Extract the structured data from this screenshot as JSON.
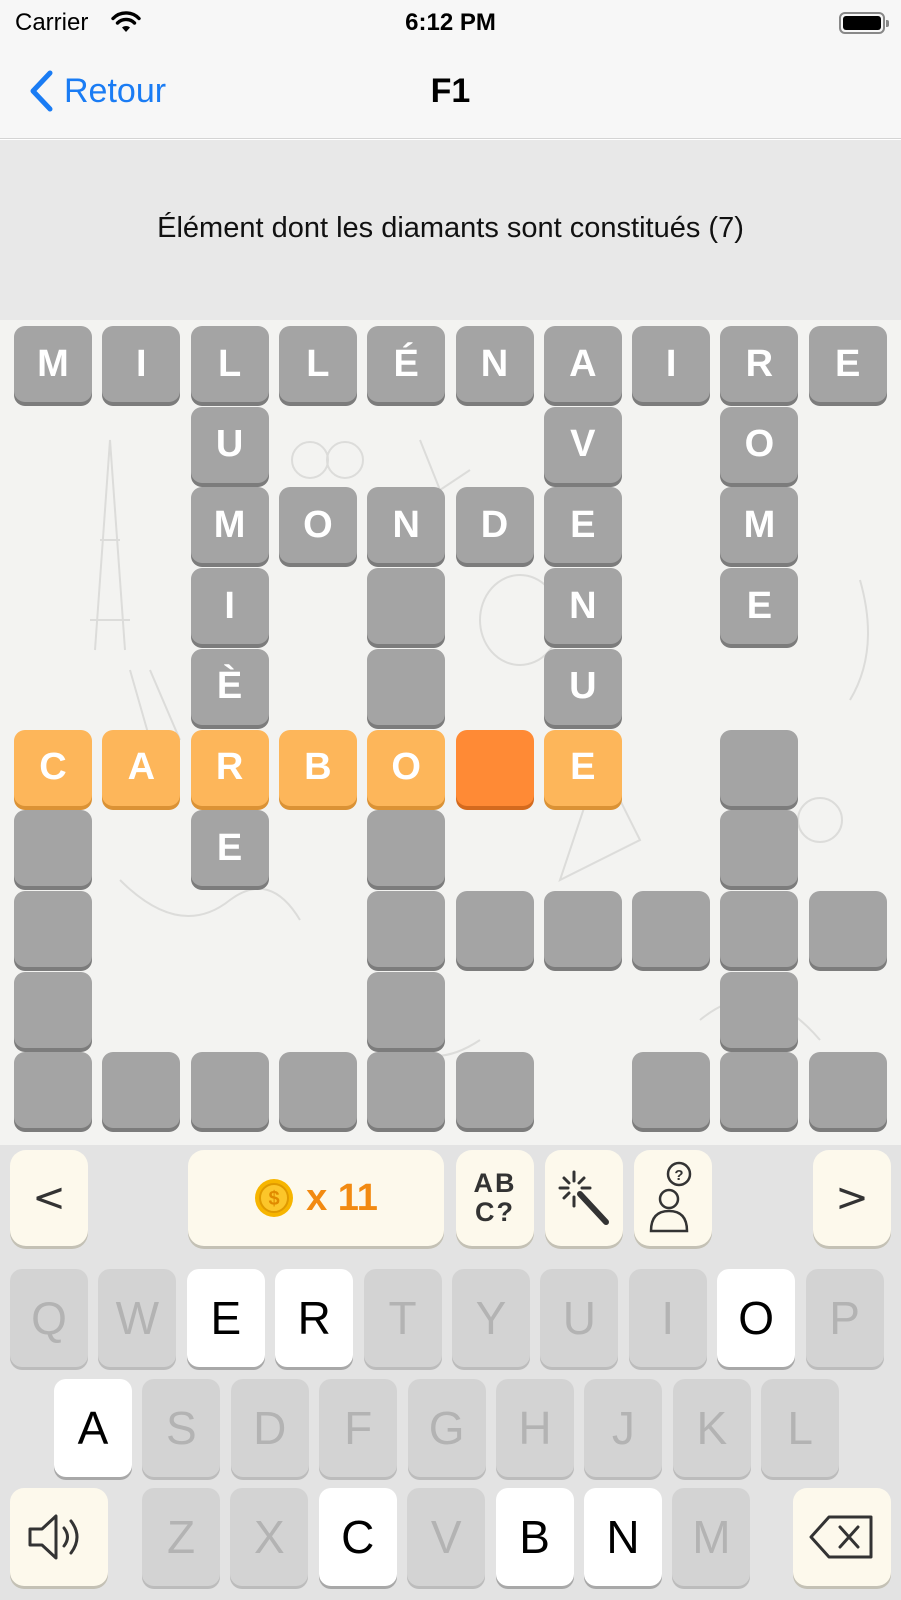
{
  "status_bar": {
    "carrier": "Carrier",
    "time": "6:12 PM"
  },
  "nav": {
    "back_label": "Retour",
    "title": "F1"
  },
  "clue": {
    "text": "Élément dont les diamants sont constitués (7)"
  },
  "colors": {
    "accent": "#1a7cf4",
    "cell_filled": "#a4a4a4",
    "cell_active": "#fdb65a",
    "cell_current": "#ff8a35",
    "coin": "#f7b500",
    "coin_text": "#f28a12"
  },
  "grid": {
    "columns": 10,
    "rows": 10,
    "cells": [
      {
        "row": 0,
        "col": 0,
        "letter": "M",
        "state": "filled"
      },
      {
        "row": 0,
        "col": 1,
        "letter": "I",
        "state": "filled"
      },
      {
        "row": 0,
        "col": 2,
        "letter": "L",
        "state": "filled"
      },
      {
        "row": 0,
        "col": 3,
        "letter": "L",
        "state": "filled"
      },
      {
        "row": 0,
        "col": 4,
        "letter": "É",
        "state": "filled"
      },
      {
        "row": 0,
        "col": 5,
        "letter": "N",
        "state": "filled"
      },
      {
        "row": 0,
        "col": 6,
        "letter": "A",
        "state": "filled"
      },
      {
        "row": 0,
        "col": 7,
        "letter": "I",
        "state": "filled"
      },
      {
        "row": 0,
        "col": 8,
        "letter": "R",
        "state": "filled"
      },
      {
        "row": 0,
        "col": 9,
        "letter": "E",
        "state": "filled"
      },
      {
        "row": 1,
        "col": 2,
        "letter": "U",
        "state": "filled"
      },
      {
        "row": 1,
        "col": 6,
        "letter": "V",
        "state": "filled"
      },
      {
        "row": 1,
        "col": 8,
        "letter": "O",
        "state": "filled"
      },
      {
        "row": 2,
        "col": 2,
        "letter": "M",
        "state": "filled"
      },
      {
        "row": 2,
        "col": 3,
        "letter": "O",
        "state": "filled"
      },
      {
        "row": 2,
        "col": 4,
        "letter": "N",
        "state": "filled"
      },
      {
        "row": 2,
        "col": 5,
        "letter": "D",
        "state": "filled"
      },
      {
        "row": 2,
        "col": 6,
        "letter": "E",
        "state": "filled"
      },
      {
        "row": 2,
        "col": 8,
        "letter": "M",
        "state": "filled"
      },
      {
        "row": 3,
        "col": 2,
        "letter": "I",
        "state": "filled"
      },
      {
        "row": 3,
        "col": 4,
        "letter": "",
        "state": "filled"
      },
      {
        "row": 3,
        "col": 6,
        "letter": "N",
        "state": "filled"
      },
      {
        "row": 3,
        "col": 8,
        "letter": "E",
        "state": "filled"
      },
      {
        "row": 4,
        "col": 2,
        "letter": "È",
        "state": "filled"
      },
      {
        "row": 4,
        "col": 4,
        "letter": "",
        "state": "filled"
      },
      {
        "row": 4,
        "col": 6,
        "letter": "U",
        "state": "filled"
      },
      {
        "row": 5,
        "col": 0,
        "letter": "C",
        "state": "active"
      },
      {
        "row": 5,
        "col": 1,
        "letter": "A",
        "state": "active"
      },
      {
        "row": 5,
        "col": 2,
        "letter": "R",
        "state": "active"
      },
      {
        "row": 5,
        "col": 3,
        "letter": "B",
        "state": "active"
      },
      {
        "row": 5,
        "col": 4,
        "letter": "O",
        "state": "active"
      },
      {
        "row": 5,
        "col": 5,
        "letter": "",
        "state": "current"
      },
      {
        "row": 5,
        "col": 6,
        "letter": "E",
        "state": "active"
      },
      {
        "row": 5,
        "col": 8,
        "letter": "",
        "state": "filled"
      },
      {
        "row": 6,
        "col": 0,
        "letter": "",
        "state": "filled"
      },
      {
        "row": 6,
        "col": 2,
        "letter": "E",
        "state": "filled"
      },
      {
        "row": 6,
        "col": 4,
        "letter": "",
        "state": "filled"
      },
      {
        "row": 6,
        "col": 8,
        "letter": "",
        "state": "filled"
      },
      {
        "row": 7,
        "col": 0,
        "letter": "",
        "state": "filled"
      },
      {
        "row": 7,
        "col": 4,
        "letter": "",
        "state": "filled"
      },
      {
        "row": 7,
        "col": 5,
        "letter": "",
        "state": "filled"
      },
      {
        "row": 7,
        "col": 6,
        "letter": "",
        "state": "filled"
      },
      {
        "row": 7,
        "col": 7,
        "letter": "",
        "state": "filled"
      },
      {
        "row": 7,
        "col": 8,
        "letter": "",
        "state": "filled"
      },
      {
        "row": 7,
        "col": 9,
        "letter": "",
        "state": "filled"
      },
      {
        "row": 8,
        "col": 0,
        "letter": "",
        "state": "filled"
      },
      {
        "row": 8,
        "col": 4,
        "letter": "",
        "state": "filled"
      },
      {
        "row": 8,
        "col": 8,
        "letter": "",
        "state": "filled"
      },
      {
        "row": 9,
        "col": 0,
        "letter": "",
        "state": "filled"
      },
      {
        "row": 9,
        "col": 1,
        "letter": "",
        "state": "filled"
      },
      {
        "row": 9,
        "col": 2,
        "letter": "",
        "state": "filled"
      },
      {
        "row": 9,
        "col": 3,
        "letter": "",
        "state": "filled"
      },
      {
        "row": 9,
        "col": 4,
        "letter": "",
        "state": "filled"
      },
      {
        "row": 9,
        "col": 5,
        "letter": "",
        "state": "filled"
      },
      {
        "row": 9,
        "col": 7,
        "letter": "",
        "state": "filled"
      },
      {
        "row": 9,
        "col": 8,
        "letter": "",
        "state": "filled"
      },
      {
        "row": 9,
        "col": 9,
        "letter": "",
        "state": "filled"
      }
    ]
  },
  "toolbar": {
    "prev_label": "<",
    "next_label": ">",
    "coins_label": "x 11",
    "coin_icon": "dollar-coin-icon",
    "abc_label_line1": "AB",
    "abc_label_line2": "C?",
    "wand_icon": "magic-wand-icon",
    "help_icon": "person-question-icon"
  },
  "keyboard": {
    "rows": [
      [
        {
          "key": "Q",
          "enabled": false
        },
        {
          "key": "W",
          "enabled": false
        },
        {
          "key": "E",
          "enabled": true
        },
        {
          "key": "R",
          "enabled": true
        },
        {
          "key": "T",
          "enabled": false
        },
        {
          "key": "Y",
          "enabled": false
        },
        {
          "key": "U",
          "enabled": false
        },
        {
          "key": "I",
          "enabled": false
        },
        {
          "key": "O",
          "enabled": true
        },
        {
          "key": "P",
          "enabled": false
        }
      ],
      [
        {
          "key": "A",
          "enabled": true
        },
        {
          "key": "S",
          "enabled": false
        },
        {
          "key": "D",
          "enabled": false
        },
        {
          "key": "F",
          "enabled": false
        },
        {
          "key": "G",
          "enabled": false
        },
        {
          "key": "H",
          "enabled": false
        },
        {
          "key": "J",
          "enabled": false
        },
        {
          "key": "K",
          "enabled": false
        },
        {
          "key": "L",
          "enabled": false
        }
      ],
      [
        {
          "key": "Z",
          "enabled": false
        },
        {
          "key": "X",
          "enabled": false
        },
        {
          "key": "C",
          "enabled": true
        },
        {
          "key": "V",
          "enabled": false
        },
        {
          "key": "B",
          "enabled": true
        },
        {
          "key": "N",
          "enabled": true
        },
        {
          "key": "M",
          "enabled": false
        }
      ]
    ],
    "sound_icon": "speaker-icon",
    "delete_icon": "backspace-icon"
  }
}
